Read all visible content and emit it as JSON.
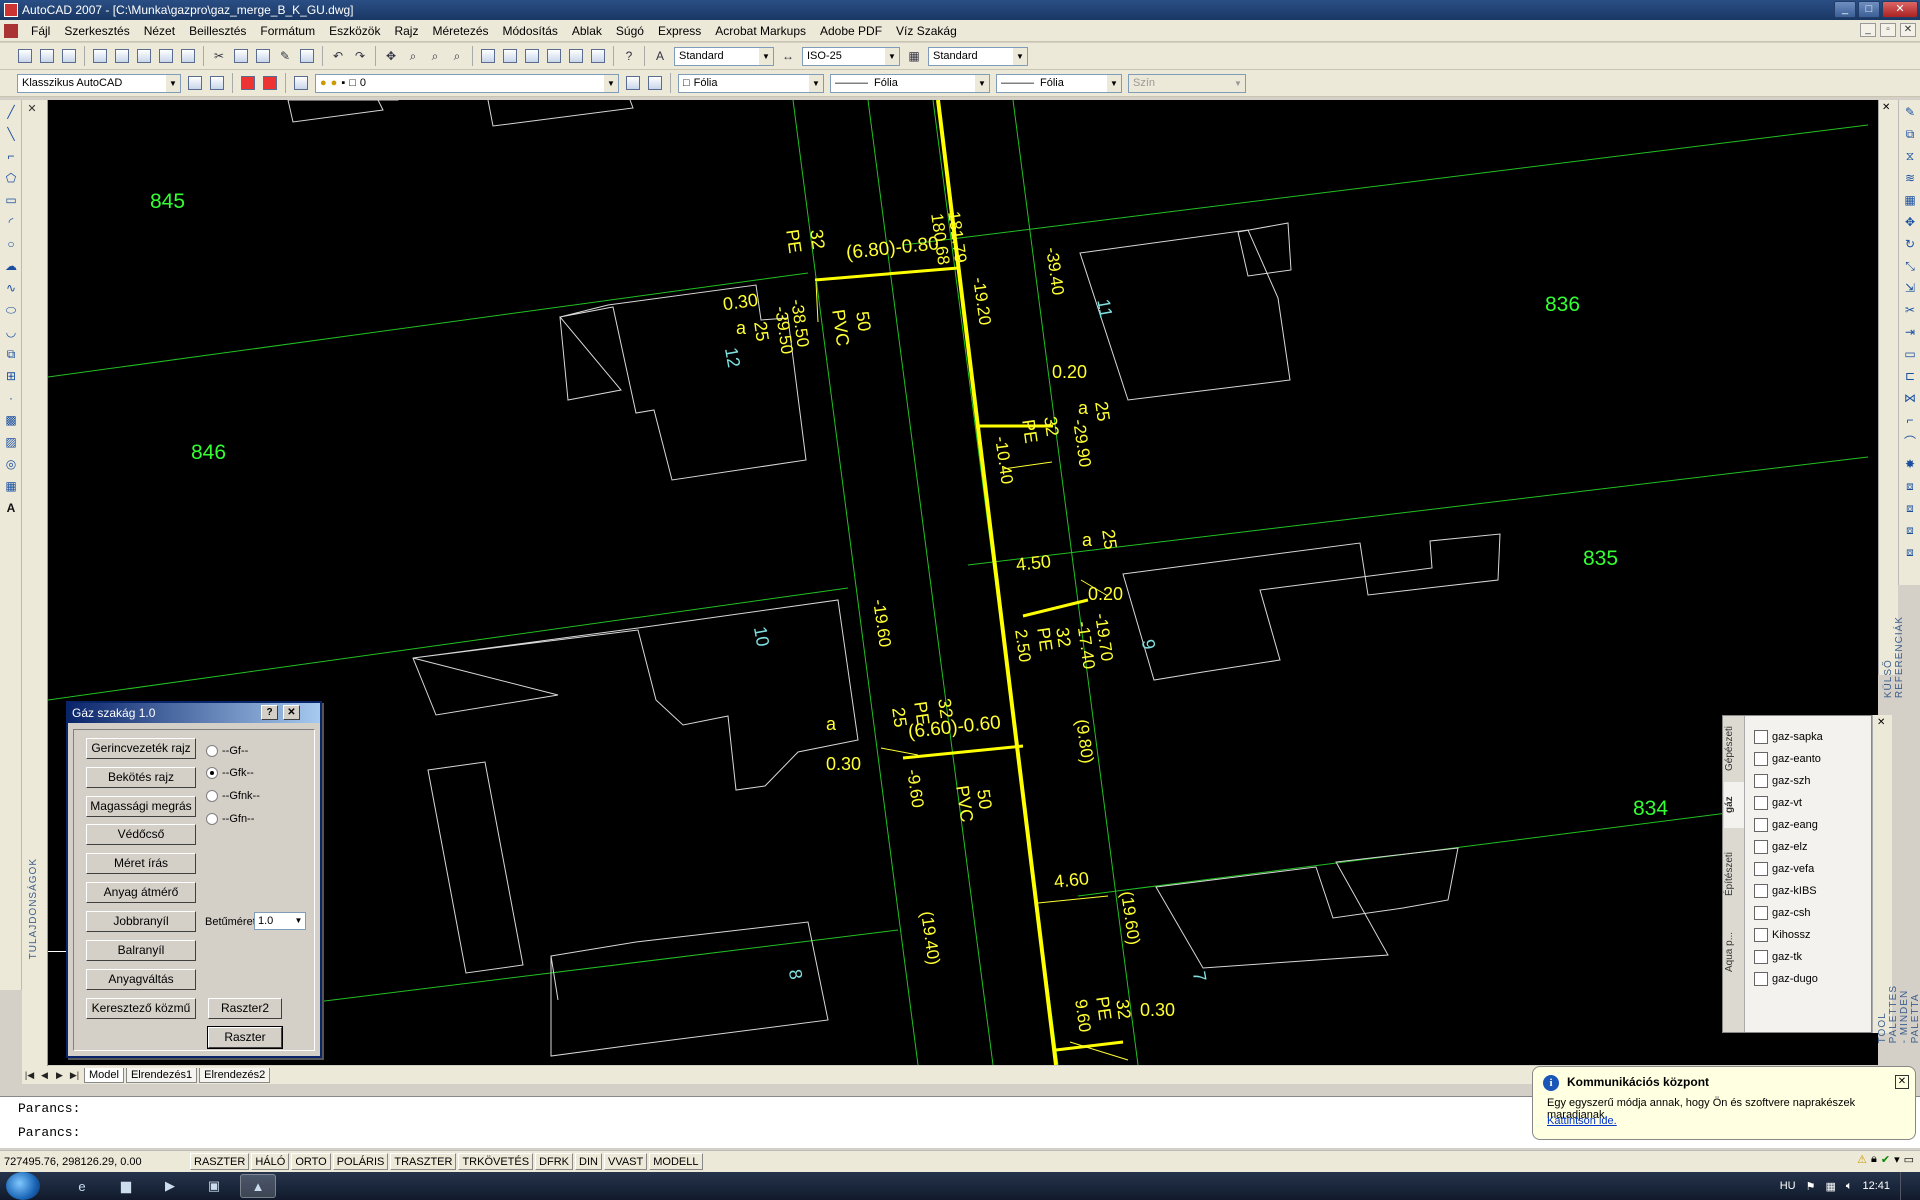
{
  "window": {
    "title": "AutoCAD 2007 - [C:\\Munka\\gazpro\\gaz_merge_B_K_GU.dwg]"
  },
  "menu": [
    "Fájl",
    "Szerkesztés",
    "Nézet",
    "Beillesztés",
    "Formátum",
    "Eszközök",
    "Rajz",
    "Méretezés",
    "Módosítás",
    "Ablak",
    "Súgó",
    "Express",
    "Acrobat Markups",
    "Adobe PDF",
    "Víz Szakág"
  ],
  "toolbar1": {
    "textstyle": "Standard",
    "dimstyle": "ISO-25",
    "tablestyle": "Standard"
  },
  "toolbar2": {
    "workspace": "Klasszikus AutoCAD",
    "layer": "0",
    "color": "Fólia",
    "linetype": "Fólia",
    "lineweight": "Fólia",
    "plotstyle": "Szín"
  },
  "side_labels": {
    "properties": "TULAJDONSÁGOK",
    "xref": "KÜLSŐ REFERENCIÁK",
    "tool_palettes": "TOOL PALETTES - MINDEN PALETTA"
  },
  "drawing": {
    "parcels": [
      "845",
      "846",
      "836",
      "835",
      "834"
    ],
    "house_numbers": [
      "11",
      "12",
      "10",
      "9",
      "8",
      "7"
    ],
    "annotations": {
      "a1": "181.79",
      "a2": "180.68",
      "a3": "(6.80)-0.80",
      "a4": "32",
      "a5": "PE",
      "a6": "-19.20",
      "a7": "-39.40",
      "a8": "0.30",
      "a9": "a",
      "a10": "25",
      "a11": "-38.50",
      "a12": "-39.50",
      "a13": "50",
      "a14": "PVC",
      "a15": "0.20",
      "a16": "25",
      "a17": "a",
      "a18": "-29.90",
      "a19": "32",
      "a20": "PE",
      "a21": "-10.40",
      "a22": "4.50",
      "a23": "a",
      "a24": "25",
      "a25": "0.20",
      "a26": "-19.70",
      "a27": "-17.40",
      "a28": "32",
      "a29": "PE",
      "a30": "2.50",
      "a31": "-19.60",
      "a32": "32",
      "a33": "PE",
      "a34": "(6.60)-0.60",
      "a35": "(9.80)",
      "a36": "a",
      "a37": "25",
      "a38": "0.30",
      "a39": "-9.60",
      "a40": "50",
      "a41": "PVC",
      "a42": "4.60",
      "a43": "(19.60)",
      "a44": "(19.40)",
      "a45": "32",
      "a46": "PE",
      "a47": "9.60",
      "a48": "0.30"
    }
  },
  "layout_tabs": [
    "Model",
    "Elrendezés1",
    "Elrendezés2"
  ],
  "command": {
    "line1": "Parancs:",
    "line2": "Parancs:"
  },
  "status": {
    "coords": "727495.76, 298126.29, 0.00",
    "buttons": [
      "RASZTER",
      "HÁLÓ",
      "ORTO",
      "POLÁRIS",
      "TRASZTER",
      "TRKÖVETÉS",
      "DFRK",
      "DIN",
      "VVAST",
      "MODELL"
    ]
  },
  "dialog": {
    "title": "Gáz szakág 1.0",
    "help": "?",
    "close": "✕",
    "buttons": [
      "Gerincvezeték rajz",
      "Bekötés rajz",
      "Magassági megrás",
      "Védőcső",
      "Méret írás",
      "Anyag átmérő",
      "Jobbranyíl",
      "Balranyíl",
      "Anyagváltás",
      "Keresztező közmű"
    ],
    "raszter2": "Raszter2",
    "raszter": "Raszter",
    "radios": [
      "--Gf--",
      "--Gfk--",
      "--Gfnk--",
      "--Gfn--"
    ],
    "selected_radio": 1,
    "font_label": "Betűméret",
    "font_value": "1.0"
  },
  "toolpalette": {
    "tabs": [
      "Gépészeti",
      "gáz",
      "Építészeti",
      "Aqua p..."
    ],
    "active_tab": "gáz",
    "items": [
      "gaz-sapka",
      "gaz-eanto",
      "gaz-szh",
      "gaz-vt",
      "gaz-eang",
      "gaz-elz",
      "gaz-vefa",
      "gaz-kIBS",
      "gaz-csh",
      "Kihossz",
      "gaz-tk",
      "gaz-dugo"
    ]
  },
  "notification": {
    "title": "Kommunikációs központ",
    "body": "Egy egyszerű módja annak, hogy Ön és szoftvere naprakészek maradjanak.",
    "link": "Kattintson ide."
  },
  "taskbar": {
    "language": "HU",
    "clock": "12:41"
  },
  "colors": {
    "canvas": "#000000",
    "parcel_line": "#22c022",
    "building_line": "#e0e0e0",
    "pipe": "#ffff00",
    "label_yellow": "#ffff33",
    "label_cyan": "#7fe0e0",
    "parcel_number": "#33ff33"
  }
}
